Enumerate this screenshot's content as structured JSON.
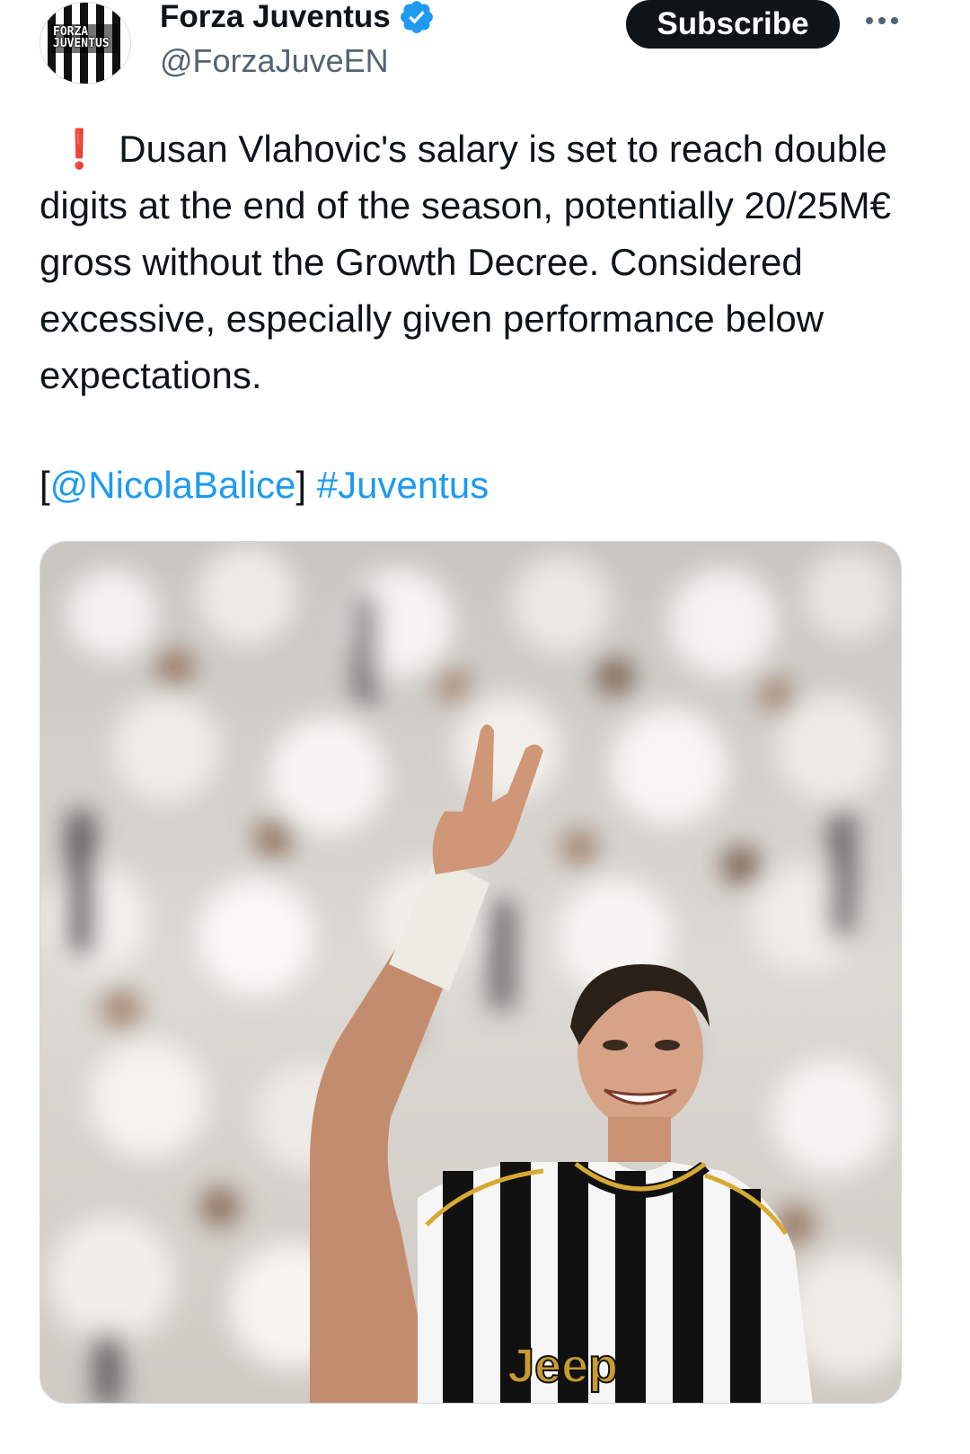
{
  "author": {
    "display_name": "Forza Juventus",
    "handle": "@ForzaJuveEN",
    "avatar_text_line1": "FORZA",
    "avatar_text_line2": "JUVENTUS",
    "verified_icon": "verified-badge-icon",
    "verified_color": "#1d9bf0"
  },
  "actions": {
    "subscribe_label": "Subscribe",
    "more_icon": "more-options-icon"
  },
  "tweet": {
    "alert_icon": "❗",
    "text": "Dusan Vlahovic's salary is set to reach double digits at the end of the season, potentially 20/25M€ gross without the Growth Decree. Considered excessive, especially given performance below expectations.",
    "open_bracket": "[",
    "mention": "@NicolaBalice",
    "close_bracket": "]",
    "hashtag": "#Juventus"
  },
  "media": {
    "description_icon": "photo-player-celebrating",
    "jersey_sponsor": "Jeep"
  },
  "colors": {
    "link": "#1d9bf0",
    "text": "#0f1419",
    "secondary": "#536471",
    "button_bg": "#0f1419"
  }
}
